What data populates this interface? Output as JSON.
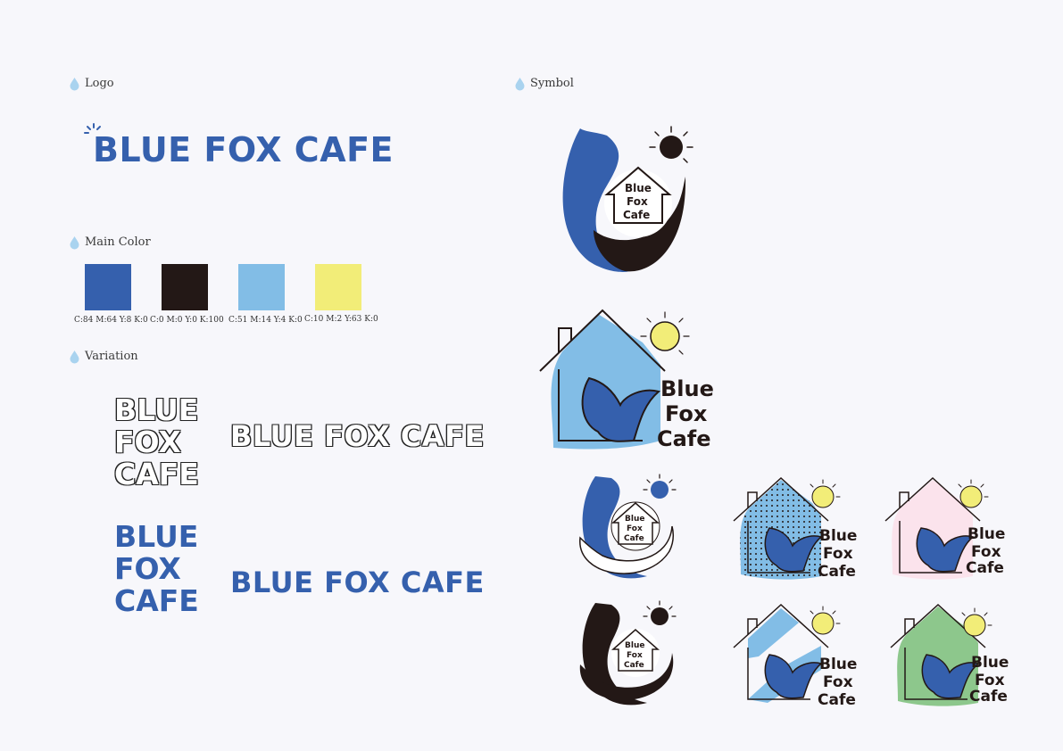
{
  "sections": {
    "logo": "Logo",
    "main_color": "Main Color",
    "variation": "Variation",
    "symbol": "Symbol"
  },
  "logo_text": "BLUE FOX CAFE",
  "stacked_logo": [
    "BLUE",
    "FOX",
    "CAFE"
  ],
  "symbol_text": [
    "Blue",
    "Fox",
    "Cafe"
  ],
  "colors": [
    {
      "hex": "#3560ad",
      "cmyk": "C:84 M:64 Y:8 K:0"
    },
    {
      "hex": "#231816",
      "cmyk": "C:0 M:0 Y:0 K:100"
    },
    {
      "hex": "#82bde6",
      "cmyk": "C:51 M:14 Y:4 K:0"
    },
    {
      "hex": "#f2ed78",
      "cmyk": "C:10 M:2 Y:63 K:0"
    }
  ]
}
